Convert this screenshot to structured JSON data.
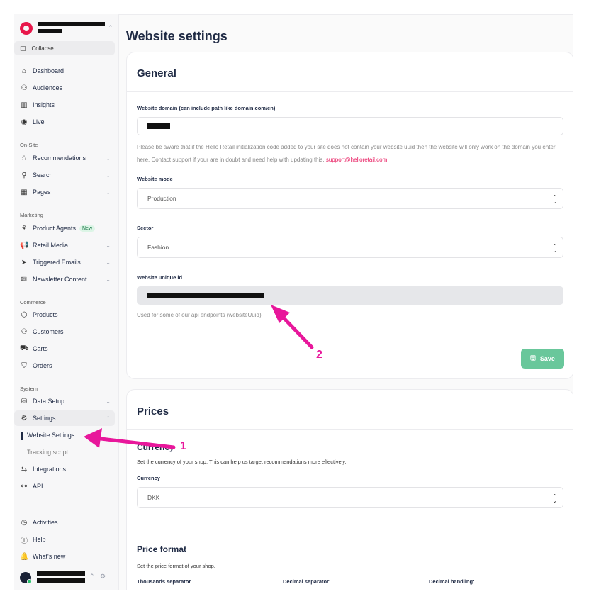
{
  "sidebar": {
    "collapse_label": "Collapse",
    "items": [
      {
        "label": "Dashboard",
        "icon": "home-icon"
      },
      {
        "label": "Audiences",
        "icon": "users-icon"
      },
      {
        "label": "Insights",
        "icon": "bar-chart-icon"
      },
      {
        "label": "Live",
        "icon": "live-icon"
      }
    ],
    "onsite": {
      "label": "On-Site",
      "items": [
        {
          "label": "Recommendations",
          "icon": "star-icon"
        },
        {
          "label": "Search",
          "icon": "search-icon"
        },
        {
          "label": "Pages",
          "icon": "pages-icon"
        }
      ]
    },
    "marketing": {
      "label": "Marketing",
      "items": [
        {
          "label": "Product Agents",
          "icon": "agent-icon",
          "badge": "New"
        },
        {
          "label": "Retail Media",
          "icon": "megaphone-icon"
        },
        {
          "label": "Triggered Emails",
          "icon": "send-icon"
        },
        {
          "label": "Newsletter Content",
          "icon": "mail-icon"
        }
      ]
    },
    "commerce": {
      "label": "Commerce",
      "items": [
        {
          "label": "Products",
          "icon": "box-icon"
        },
        {
          "label": "Customers",
          "icon": "customers-icon"
        },
        {
          "label": "Carts",
          "icon": "cart-icon"
        },
        {
          "label": "Orders",
          "icon": "bag-icon"
        }
      ]
    },
    "system": {
      "label": "System",
      "items": [
        {
          "label": "Data Setup",
          "icon": "database-icon"
        },
        {
          "label": "Settings",
          "icon": "gear-icon"
        }
      ],
      "settings_sub": [
        "Website Settings",
        "Tracking script"
      ],
      "after": [
        {
          "label": "Integrations",
          "icon": "integrations-icon"
        },
        {
          "label": "API",
          "icon": "api-icon"
        }
      ]
    },
    "bottom": [
      {
        "label": "Activities",
        "icon": "history-icon"
      },
      {
        "label": "Help",
        "icon": "help-icon"
      },
      {
        "label": "What's new",
        "icon": "bell-icon"
      }
    ]
  },
  "main": {
    "title": "Website settings",
    "general": {
      "title": "General",
      "domain_label": "Website domain (can include path like domain.com/en)",
      "domain_help": "Please be aware that if the Hello Retail initialization code added to your site does not contain your website uuid then the website will only work on the domain you enter here. Contact support if your are in doubt and need help with updating this.",
      "support_email": "support@helloretail.com",
      "mode_label": "Website mode",
      "mode_value": "Production",
      "sector_label": "Sector",
      "sector_value": "Fashion",
      "uid_label": "Website unique id",
      "uid_help": "Used for some of our api endpoints (websiteUuid)",
      "save_label": "Save"
    },
    "prices": {
      "title": "Prices",
      "currency_title": "Currency",
      "currency_desc": "Set the currency of your shop. This can help us target recommendations more effectively.",
      "currency_label": "Currency",
      "currency_value": "DKK",
      "format_title": "Price format",
      "format_desc": "Set the price format of your shop.",
      "thousands_label": "Thousands separator",
      "decimal_label": "Decimal separator:",
      "decimal_handling_label": "Decimal handling:"
    }
  },
  "annotations": {
    "one": "1",
    "two": "2",
    "color": "#e8179b"
  }
}
